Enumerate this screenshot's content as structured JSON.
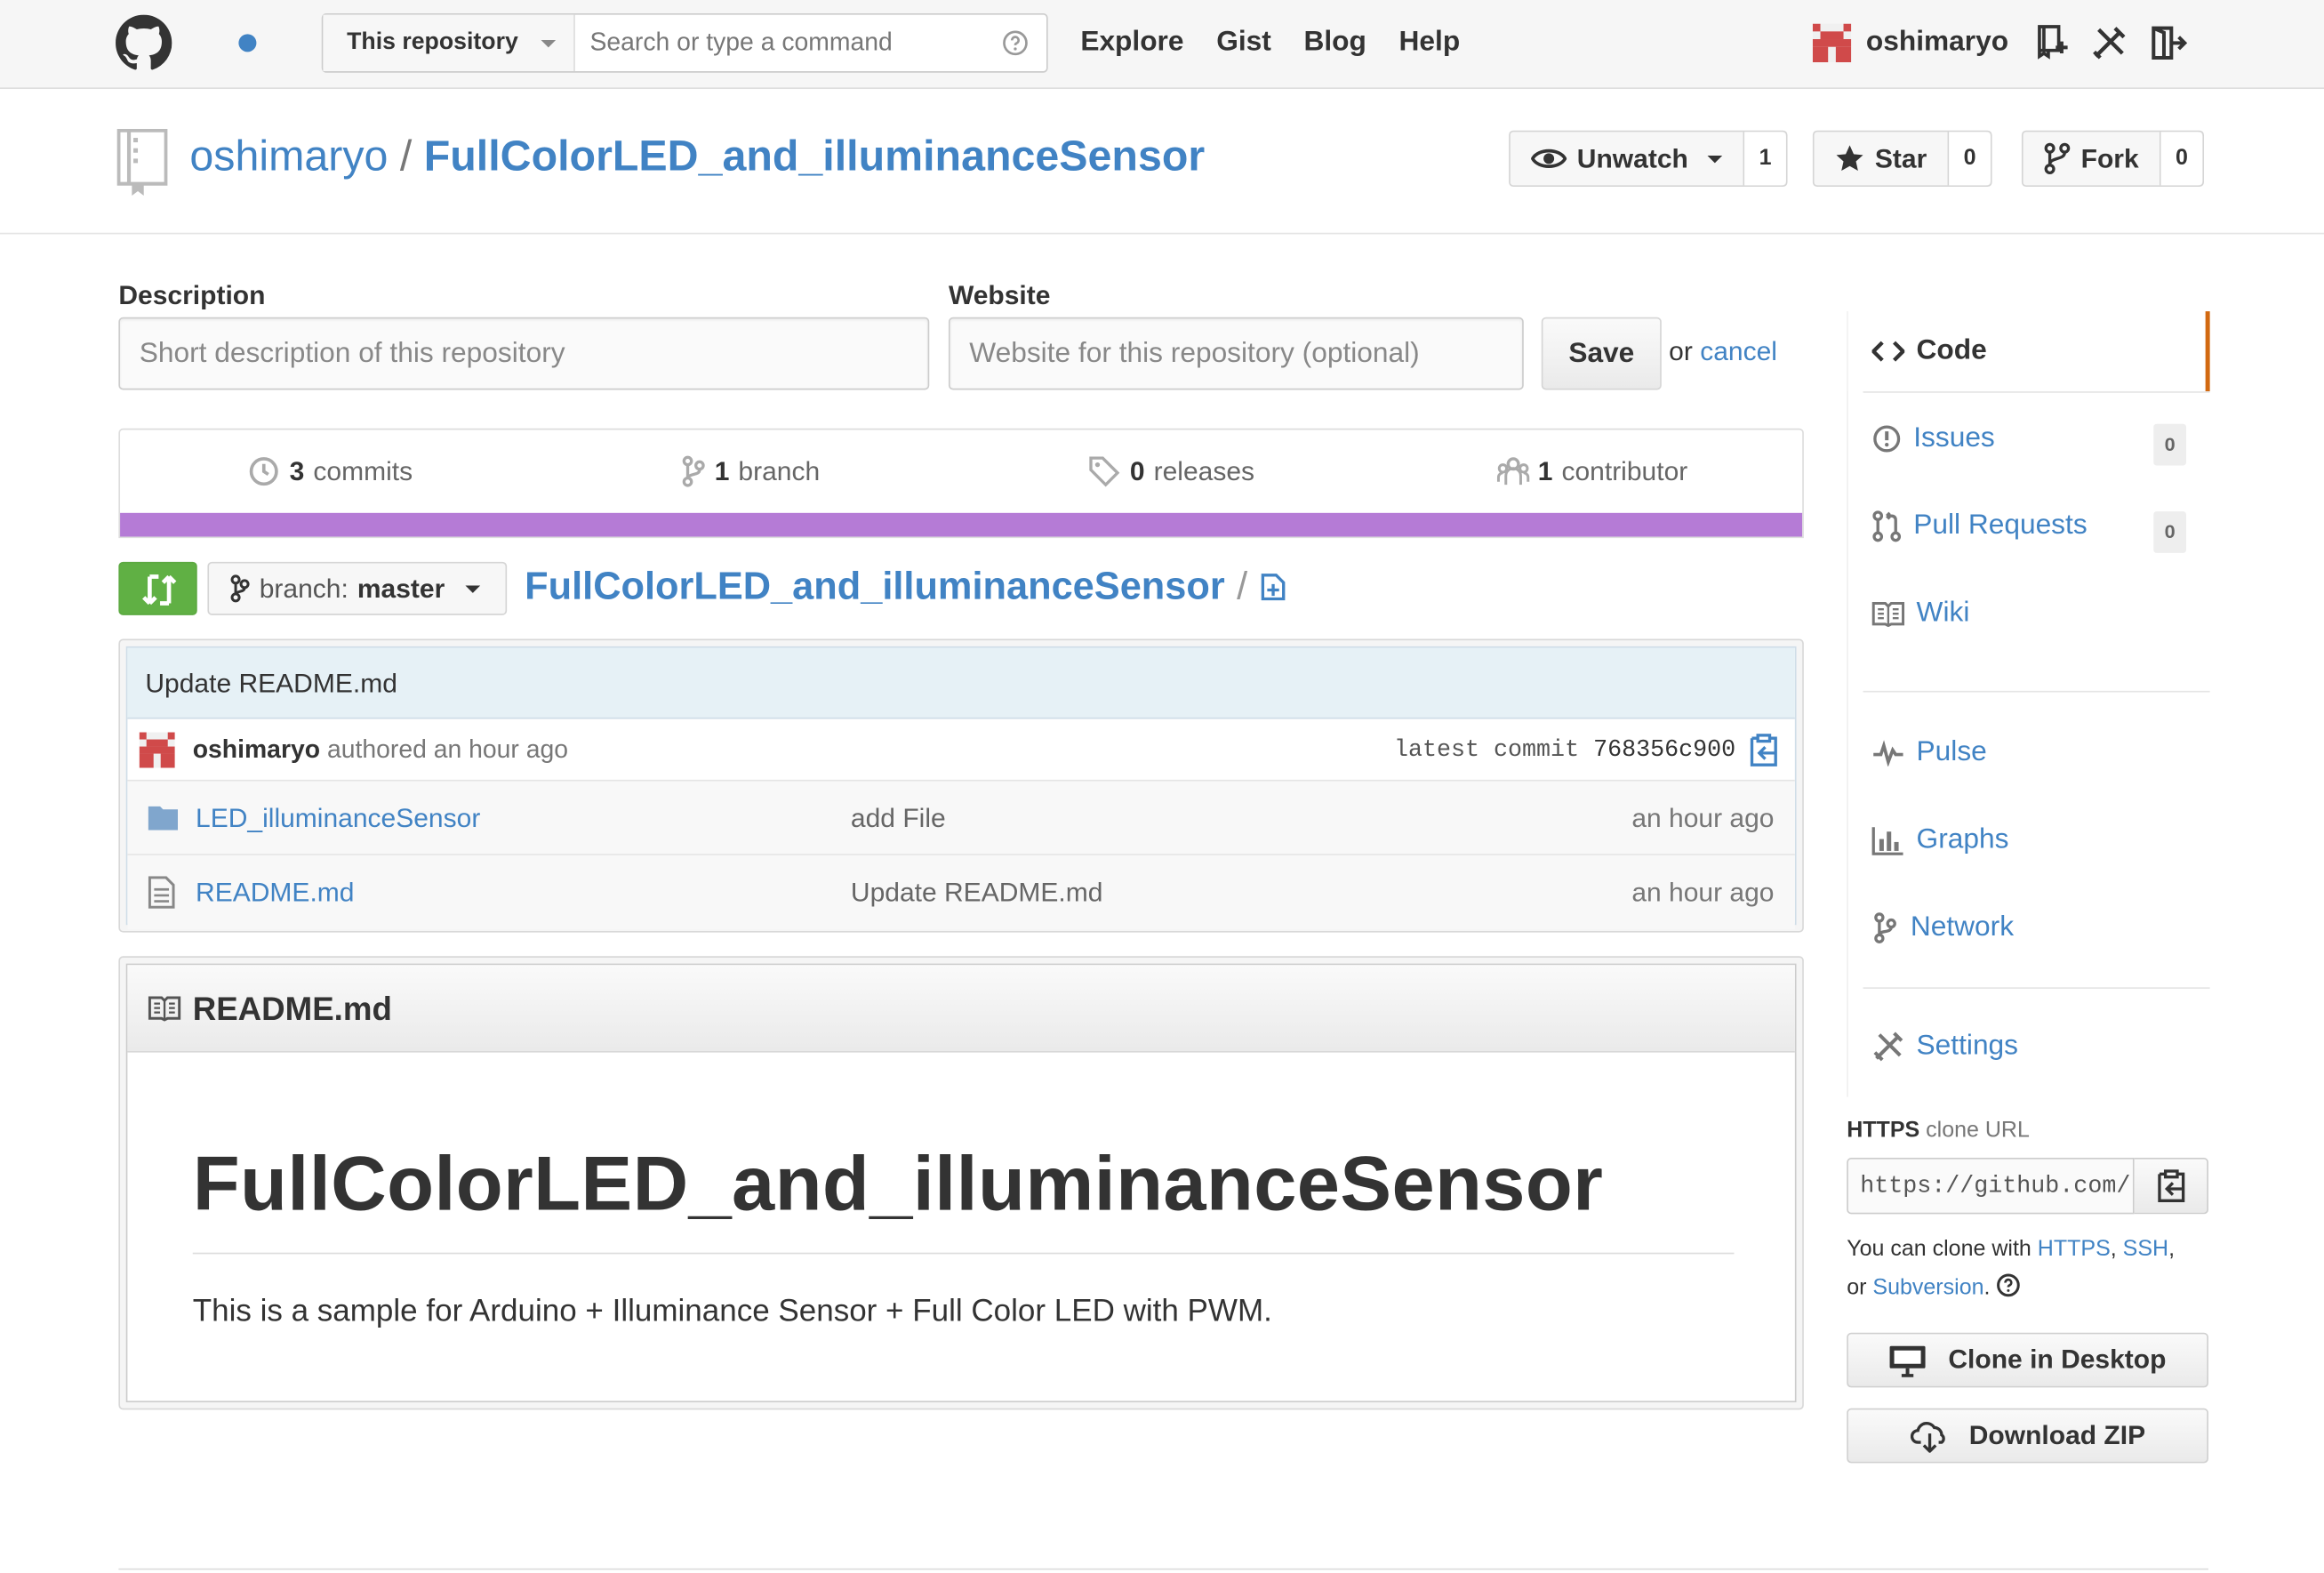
{
  "header": {
    "search_scope": "This repository",
    "search_placeholder": "Search or type a command",
    "nav": [
      "Explore",
      "Gist",
      "Blog",
      "Help"
    ],
    "username": "oshimaryo"
  },
  "repo": {
    "owner": "oshimaryo",
    "separator": "/",
    "name": "FullColorLED_and_illuminanceSensor",
    "watch_label": "Unwatch",
    "watch_count": "1",
    "star_label": "Star",
    "star_count": "0",
    "fork_label": "Fork",
    "fork_count": "0"
  },
  "edit_form": {
    "description_label": "Description",
    "description_placeholder": "Short description of this repository",
    "website_label": "Website",
    "website_placeholder": "Website for this repository (optional)",
    "save_label": "Save",
    "or_text": "or",
    "cancel_label": "cancel"
  },
  "stats": {
    "commits_num": "3",
    "commits_label": "commits",
    "branches_num": "1",
    "branches_label": "branch",
    "releases_num": "0",
    "releases_label": "releases",
    "contributors_num": "1",
    "contributors_label": "contributor",
    "language_color": "#b57bd6"
  },
  "branch": {
    "prefix": "branch:",
    "name": "master",
    "path_root": "FullColorLED_and_illuminanceSensor",
    "path_sep": "/"
  },
  "commit": {
    "message": "Update README.md",
    "author": "oshimaryo",
    "authored_text": "authored an hour ago",
    "latest_label": "latest commit",
    "sha": "768356c900"
  },
  "files": [
    {
      "icon": "folder-icon",
      "name": "LED_illuminanceSensor",
      "message": "add File",
      "age": "an hour ago"
    },
    {
      "icon": "file-icon",
      "name": "README.md",
      "message": "Update README.md",
      "age": "an hour ago"
    }
  ],
  "readme": {
    "filename": "README.md",
    "heading": "FullColorLED_and_illuminanceSensor",
    "paragraph": "This is a sample for Arduino + Illuminance Sensor + Full Color LED with PWM."
  },
  "sidebar": {
    "items": [
      {
        "label": "Code",
        "icon": "code-icon"
      },
      {
        "label": "Issues",
        "icon": "issue-icon",
        "count": "0"
      },
      {
        "label": "Pull Requests",
        "icon": "pull-request-icon",
        "count": "0"
      },
      {
        "label": "Wiki",
        "icon": "book-icon"
      },
      {
        "label": "Pulse",
        "icon": "pulse-icon"
      },
      {
        "label": "Graphs",
        "icon": "graph-icon"
      },
      {
        "label": "Network",
        "icon": "network-icon"
      },
      {
        "label": "Settings",
        "icon": "tools-icon"
      }
    ],
    "clone_protocol": "HTTPS",
    "clone_label": "clone URL",
    "clone_url": "https://github.com/",
    "clone_help_1": "You can clone with",
    "clone_https": "HTTPS",
    "clone_ssh": "SSH",
    "clone_or": "or",
    "clone_svn": "Subversion",
    "clone_desktop": "Clone in Desktop",
    "download_zip": "Download ZIP"
  },
  "colors": {
    "link": "#4183c4",
    "accent_orange": "#d26911",
    "compare_green": "#60b044"
  }
}
